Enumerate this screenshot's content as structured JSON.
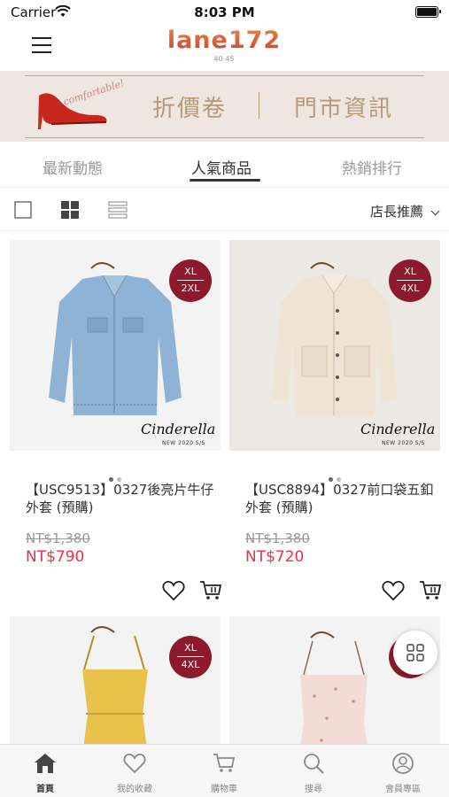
{
  "status_bar": {
    "carrier": "Carrier",
    "time": "8:03 PM"
  },
  "nav": {
    "logo_text": "lane172",
    "logo_sub": "40-45"
  },
  "banner": {
    "script_text": "comfortable!",
    "coupon_label": "折價卷",
    "store_label": "門市資訊"
  },
  "tabs": [
    {
      "label": "最新動態",
      "active": false
    },
    {
      "label": "人氣商品",
      "active": true
    },
    {
      "label": "熱銷排行",
      "active": false
    }
  ],
  "toolbar": {
    "sort_label": "店長推薦"
  },
  "products": [
    {
      "name": "【USC9513】0327後亮片牛仔外套 (預購)",
      "original_price": "NT$1,380",
      "price": "NT$790",
      "badge_top": "XL",
      "badge_bottom": "2XL",
      "brand_mark": "Cinderella",
      "season": "NEW 2020 S/S"
    },
    {
      "name": "【USC8894】0327前口袋五釦外套 (預購)",
      "original_price": "NT$1,380",
      "price": "NT$720",
      "badge_top": "XL",
      "badge_bottom": "4XL",
      "brand_mark": "Cinderella",
      "season": "NEW 2020 S/S"
    },
    {
      "badge_top": "XL",
      "badge_bottom": "4XL"
    },
    {}
  ],
  "bottom_nav": [
    {
      "label": "首頁",
      "icon": "home-icon",
      "active": true
    },
    {
      "label": "我的收藏",
      "icon": "heart-icon",
      "active": false
    },
    {
      "label": "購物車",
      "icon": "cart-icon",
      "active": false
    },
    {
      "label": "搜尋",
      "icon": "search-icon",
      "active": false
    },
    {
      "label": "會員專區",
      "icon": "user-icon",
      "active": false
    }
  ],
  "colors": {
    "accent_price": "#e3344a",
    "badge": "#8c1a2c",
    "banner_text": "#b59a7a",
    "banner_bg": "#f0e6e1"
  }
}
